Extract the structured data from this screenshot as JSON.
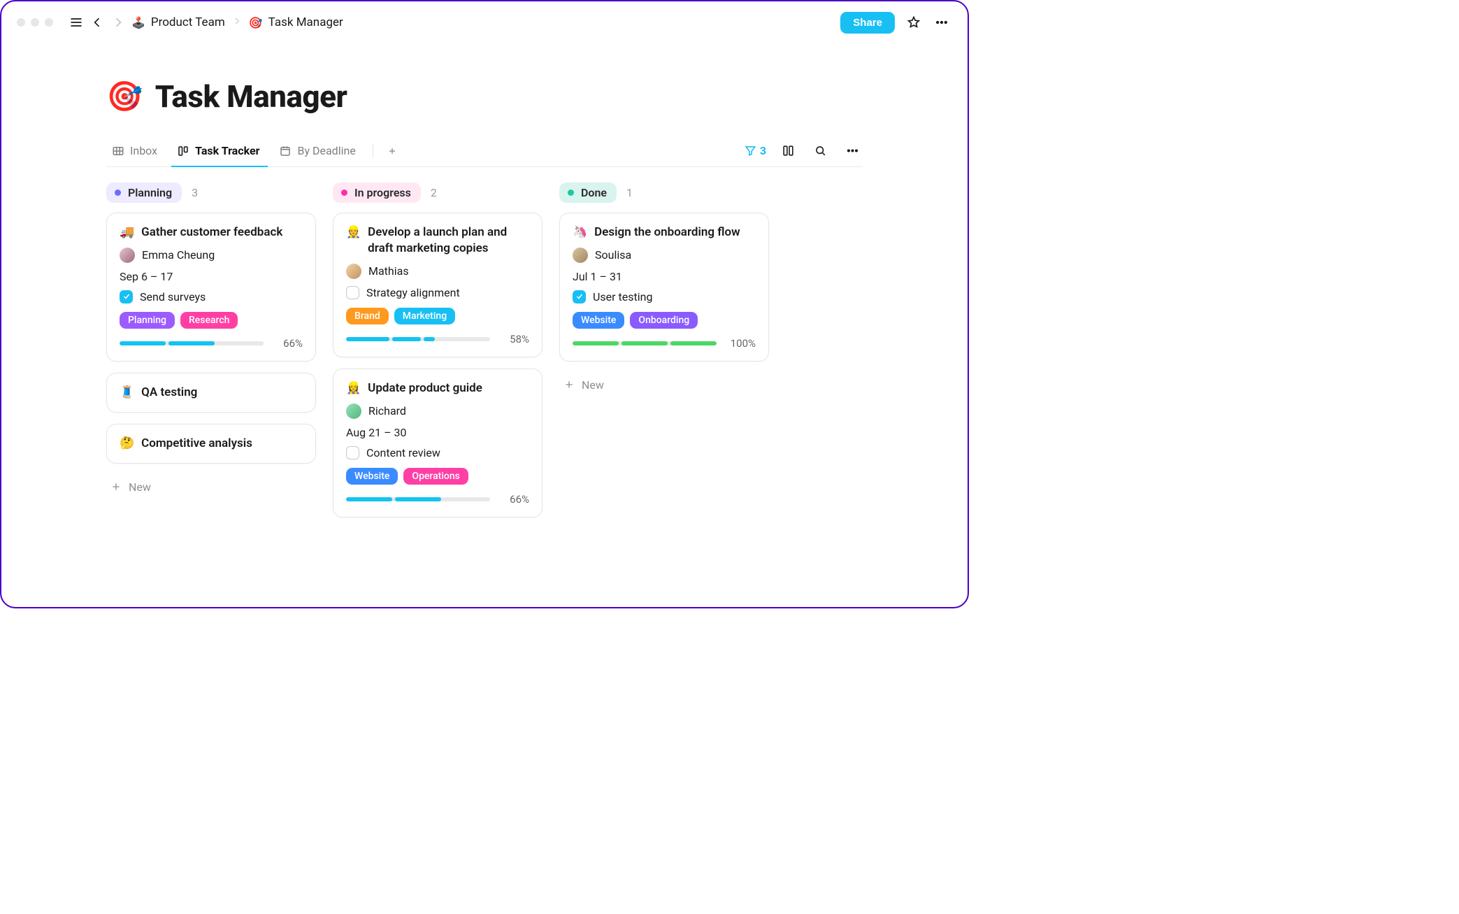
{
  "header": {
    "breadcrumbs": [
      {
        "emoji": "🕹️",
        "label": "Product Team"
      },
      {
        "emoji": "🎯",
        "label": "Task Manager"
      }
    ],
    "share_label": "Share"
  },
  "page": {
    "emoji": "🎯",
    "title": "Task Manager"
  },
  "tabs": {
    "items": [
      {
        "label": "Inbox"
      },
      {
        "label": "Task Tracker"
      },
      {
        "label": "By Deadline"
      }
    ],
    "filter_count": "3"
  },
  "board": {
    "columns": [
      {
        "key": "planning",
        "label": "Planning",
        "count": "3",
        "cards": [
          {
            "emoji": "🚚",
            "title": "Gather customer feedback",
            "assignee": "Emma Cheung",
            "date": "Sep 6 – 17",
            "check": {
              "done": true,
              "label": "Send surveys"
            },
            "tags": [
              {
                "label": "Planning",
                "cls": "purple"
              },
              {
                "label": "Research",
                "cls": "pink"
              }
            ],
            "progress": {
              "segments": [
                34,
                34,
                0
              ],
              "color": "cyan",
              "pct": "66%"
            }
          },
          {
            "emoji": "🧵",
            "title": "QA testing",
            "simple": true
          },
          {
            "emoji": "🤔",
            "title": "Competitive analysis",
            "simple": true
          }
        ],
        "new_label": "New"
      },
      {
        "key": "progress",
        "label": "In progress",
        "count": "2",
        "cards": [
          {
            "emoji": "👷",
            "title": "Develop a launch plan and draft marketing copies",
            "assignee": "Mathias",
            "check": {
              "done": false,
              "label": "Strategy alignment"
            },
            "tags": [
              {
                "label": "Brand",
                "cls": "orange"
              },
              {
                "label": "Marketing",
                "cls": "cyan"
              }
            ],
            "progress": {
              "segments": [
                30,
                20,
                8
              ],
              "color": "cyan",
              "pct": "58%"
            }
          },
          {
            "emoji": "👷‍♀️",
            "title": "Update product guide",
            "assignee": "Richard",
            "date": "Aug 21 – 30",
            "check": {
              "done": false,
              "label": "Content review"
            },
            "tags": [
              {
                "label": "Website",
                "cls": "blue"
              },
              {
                "label": "Operations",
                "cls": "pink"
              }
            ],
            "progress": {
              "segments": [
                34,
                34,
                0
              ],
              "color": "cyan",
              "pct": "66%"
            }
          }
        ]
      },
      {
        "key": "done",
        "label": "Done",
        "count": "1",
        "cards": [
          {
            "emoji": "🦄",
            "title": "Design the onboarding flow",
            "assignee": "Soulisa",
            "date": "Jul 1 – 31",
            "check": {
              "done": true,
              "label": "User testing"
            },
            "tags": [
              {
                "label": "Website",
                "cls": "blue"
              },
              {
                "label": "Onboarding",
                "cls": "violet"
              }
            ],
            "progress": {
              "segments": [
                34,
                34,
                34
              ],
              "color": "green",
              "pct": "100%"
            }
          }
        ],
        "new_label": "New"
      }
    ]
  }
}
